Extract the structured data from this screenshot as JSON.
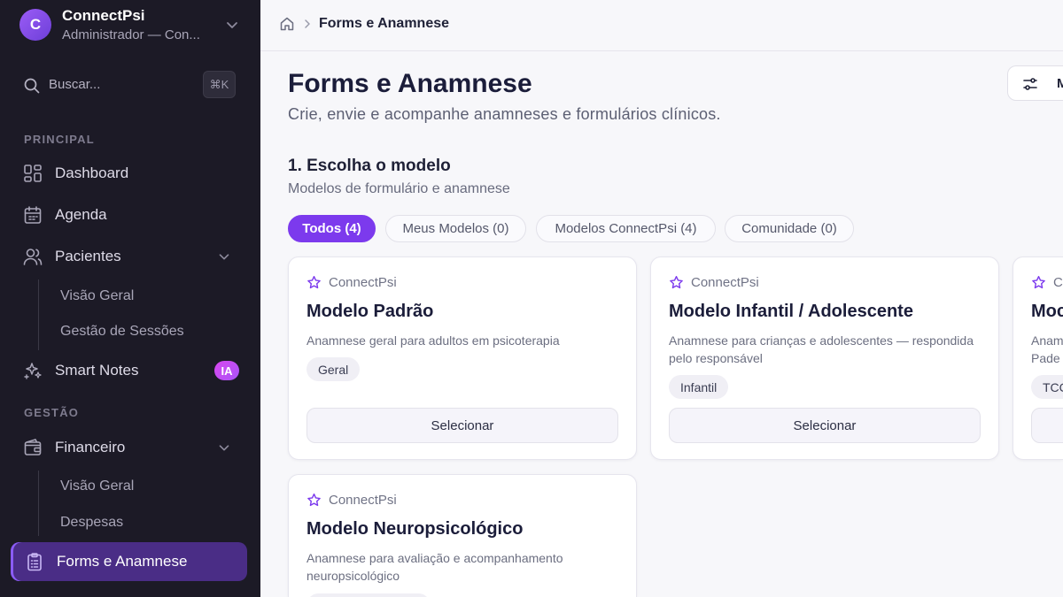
{
  "workspace": {
    "initial": "C",
    "name": "ConnectPsi",
    "subtitle": "Administrador — Con..."
  },
  "search": {
    "placeholder": "Buscar...",
    "shortcut": "⌘K"
  },
  "sidebar": {
    "section_principal": "PRINCIPAL",
    "section_gestao": "GESTÃO",
    "items": {
      "dashboard": "Dashboard",
      "agenda": "Agenda",
      "pacientes": "Pacientes",
      "pacientes_visao": "Visão Geral",
      "pacientes_sessoes": "Gestão de Sessões",
      "smart_notes": "Smart Notes",
      "smart_notes_badge": "IA",
      "financeiro": "Financeiro",
      "financeiro_visao": "Visão Geral",
      "financeiro_despesas": "Despesas",
      "forms": "Forms e Anamnese"
    }
  },
  "breadcrumb": {
    "current": "Forms e Anamnese"
  },
  "header": {
    "title": "Forms e Anamnese",
    "subtitle": "Crie, envie e acompanhe anamneses e formulários clínicos.",
    "action_label": "M"
  },
  "step": {
    "title": "1. Escolha o modelo",
    "subtitle": "Modelos de formulário e anamnese"
  },
  "filters": [
    {
      "label": "Todos (4)",
      "active": true
    },
    {
      "label": "Meus Modelos (0)",
      "active": false
    },
    {
      "label": "Modelos ConnectPsi (4)",
      "active": false
    },
    {
      "label": "Comunidade (0)",
      "active": false
    }
  ],
  "cards": [
    {
      "source": "ConnectPsi",
      "title": "Modelo Padrão",
      "description": "Anamnese geral para adultos em psicoterapia",
      "tag": "Geral",
      "button": "Selecionar"
    },
    {
      "source": "ConnectPsi",
      "title": "Modelo Infantil / Adolescente",
      "description": "Anamnese para crianças e adolescentes — respondida pelo responsável",
      "tag": "Infantil",
      "button": "Selecionar"
    },
    {
      "source": "Co",
      "title": "Moc",
      "description": "Anam Pade",
      "tag": "TCC",
      "button": ""
    },
    {
      "source": "ConnectPsi",
      "title": "Modelo Neuropsicológico",
      "description": "Anamnese para avaliação e acompanhamento neuropsicológico",
      "tag": "",
      "button": ""
    }
  ],
  "colors": {
    "accent": "#7c3aed",
    "sidebar_bg": "#1c1a26",
    "active_nav": "#4a2d86",
    "badge": "#d946ef"
  }
}
